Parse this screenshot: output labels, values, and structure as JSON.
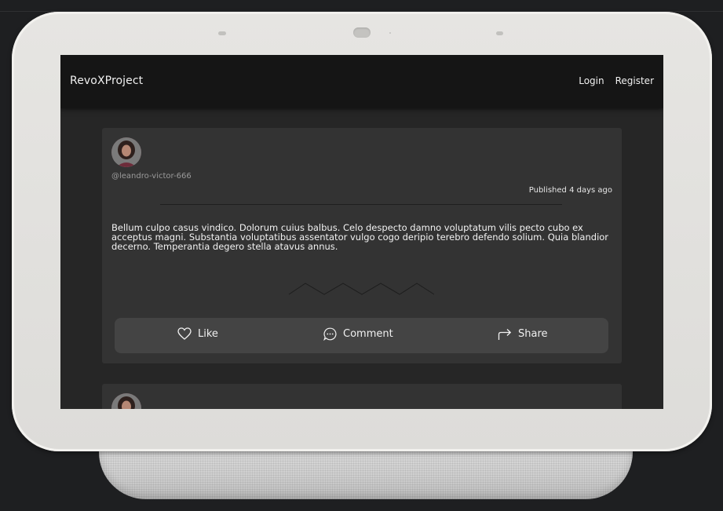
{
  "navbar": {
    "brand": "RevoXProject",
    "links": [
      "Login",
      "Register"
    ]
  },
  "post": {
    "handle": "@leandro-victor-666",
    "published": "Published 4 days ago",
    "body": "Bellum culpo casus vindico. Dolorum cuius balbus. Celo despecto damno voluptatum vilis pecto cubo ex acceptus magni. Substantia voluptatibus assentator vulgo cogo deripio terebro defendo solium. Quia blandior decerno. Temperantia degero stella atavus annus.",
    "actions": {
      "like": "Like",
      "comment": "Comment",
      "share": "Share"
    }
  },
  "icons": [
    "heart-icon",
    "comment-icon",
    "share-icon"
  ],
  "colors": {
    "navbar": "#151515",
    "card": "#333333",
    "action_bar": "#444444"
  }
}
